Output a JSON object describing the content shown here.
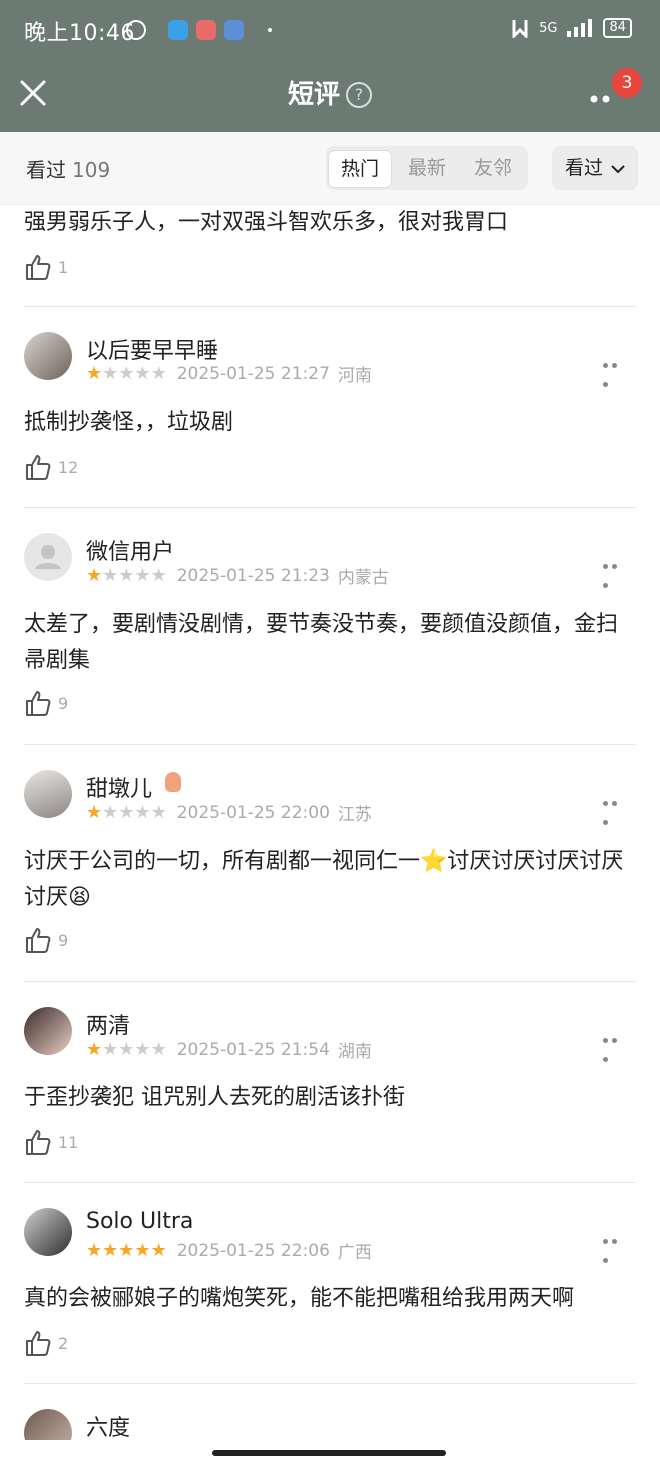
{
  "status_bar": {
    "time": "晚上10:46",
    "network": "5G",
    "battery": "84"
  },
  "header": {
    "title": "短评",
    "help_glyph": "?",
    "notification_count": "3"
  },
  "filter_bar": {
    "seen_label": "看过",
    "seen_count": "109",
    "tabs": [
      "热门",
      "最新",
      "友邻"
    ],
    "active_tab": "热门",
    "dropdown_label": "看过"
  },
  "top_partial": {
    "text": "强男弱乐子人，一对双强斗智欢乐多，很对我胃口",
    "likes": "1"
  },
  "reviews": [
    {
      "user": "以后要早早睡",
      "rating": 1,
      "date": "2025-01-25 21:27",
      "region": "河南",
      "text": "抵制抄袭怪，，垃圾剧",
      "likes": "12",
      "avatar": "photo"
    },
    {
      "user": "微信用户",
      "rating": 1,
      "date": "2025-01-25 21:23",
      "region": "内蒙古",
      "text": "太差了，要剧情没剧情，要节奏没节奏，要颜值没颜值，金扫帚剧集",
      "likes": "9",
      "avatar": "default"
    },
    {
      "user": "甜墩儿",
      "rating": 1,
      "date": "2025-01-25 22:00",
      "region": "江苏",
      "text": "讨厌于公司的一切，所有剧都一视同仁一⭐讨厌讨厌讨厌讨厌讨厌😫",
      "likes": "9",
      "avatar": "photo"
    },
    {
      "user": "两清",
      "rating": 1,
      "date": "2025-01-25 21:54",
      "region": "湖南",
      "text": "于歪抄袭犯 诅咒别人去死的剧活该扑街",
      "likes": "11",
      "avatar": "photo"
    },
    {
      "user": "Solo Ultra",
      "rating": 5,
      "date": "2025-01-25 22:06",
      "region": "广西",
      "text": "真的会被郦娘子的嘴炮笑死，能不能把嘴租给我用两天啊",
      "likes": "2",
      "avatar": "photo"
    },
    {
      "user": "六度",
      "rating": 0,
      "date": "",
      "region": "",
      "text": "",
      "likes": "",
      "avatar": "photo"
    }
  ],
  "colors": {
    "header_bg": "#6c7a74",
    "star_on": "#f5a623",
    "badge": "#e8463d"
  }
}
